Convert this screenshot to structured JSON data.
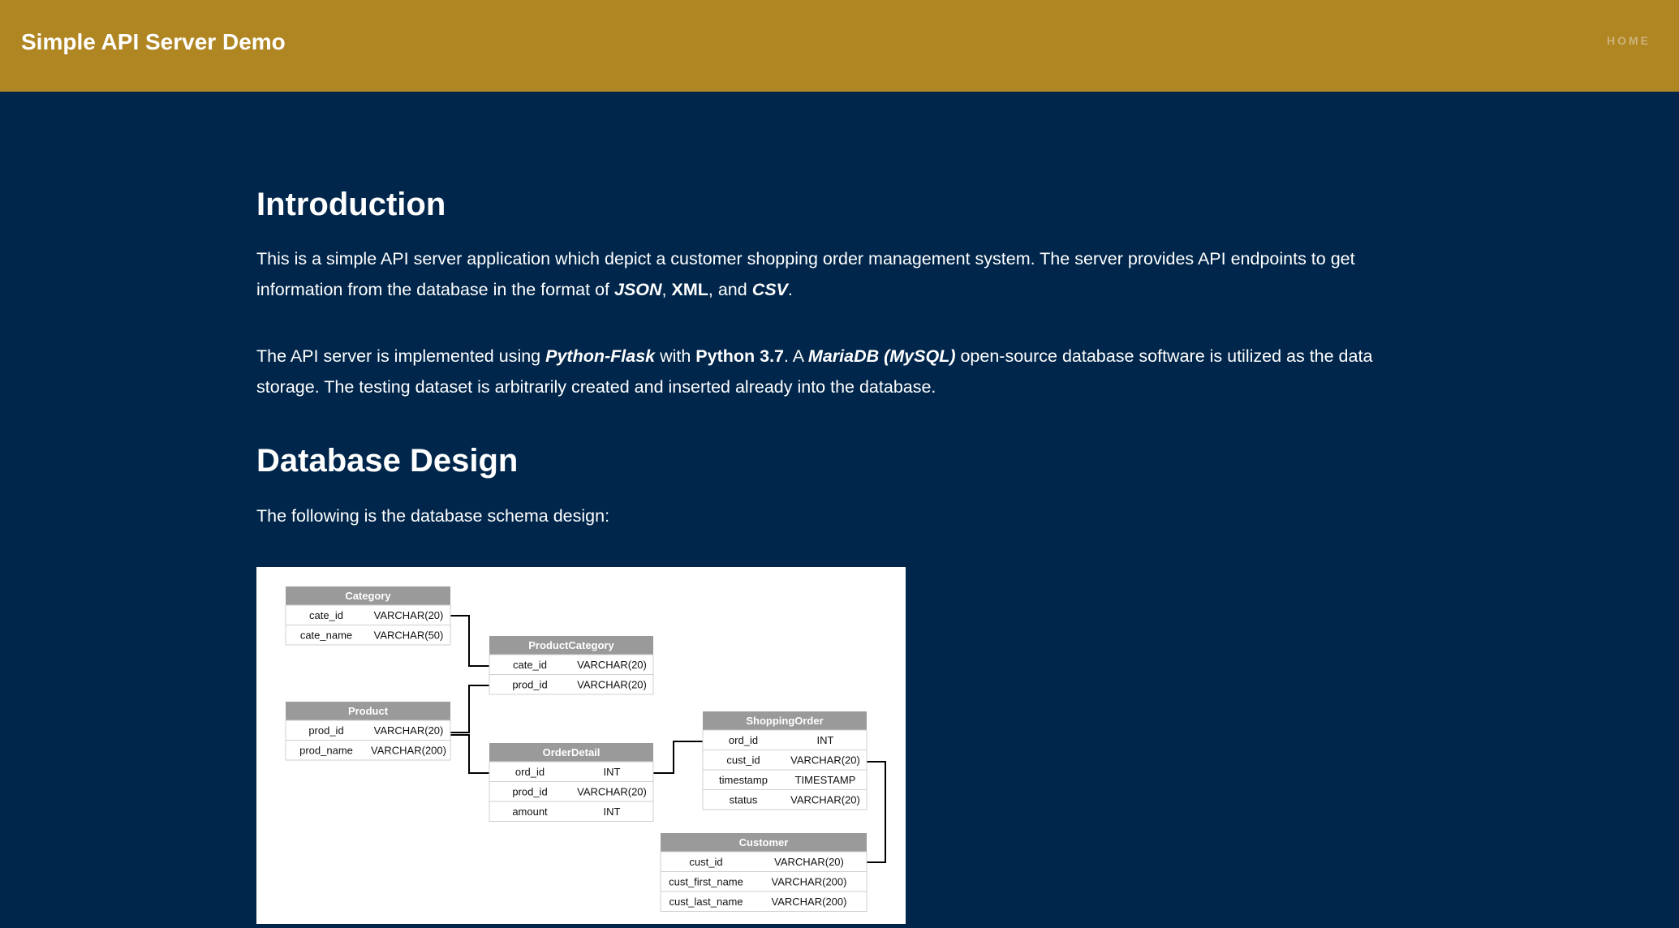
{
  "header": {
    "brand": "Simple API Server Demo",
    "nav_home": "HOME"
  },
  "intro": {
    "heading": "Introduction",
    "p1": {
      "t1": "This is a simple API server application which depict a customer shopping order management system. The server provides API endpoints to get information from the database in the format of ",
      "json": "JSON",
      "sep1": ", ",
      "xml": "XML",
      "sep2": ", and ",
      "csv": "CSV",
      "end": "."
    },
    "p2": {
      "t1": "The API server is implemented using ",
      "flask": "Python-Flask",
      "t2": " with ",
      "python": "Python 3.7",
      "t3": ". A ",
      "mariadb": "MariaDB (MySQL)",
      "t4": " open-source database software is utilized as the data storage. The testing dataset is arbitrarily created and inserted already into the database."
    }
  },
  "db": {
    "heading": "Database Design",
    "lead": "The following is the database schema design:"
  },
  "schema": {
    "tables": [
      {
        "name": "Category",
        "rows": [
          [
            "cate_id",
            "VARCHAR(20)"
          ],
          [
            "cate_name",
            "VARCHAR(50)"
          ]
        ]
      },
      {
        "name": "ProductCategory",
        "rows": [
          [
            "cate_id",
            "VARCHAR(20)"
          ],
          [
            "prod_id",
            "VARCHAR(20)"
          ]
        ]
      },
      {
        "name": "Product",
        "rows": [
          [
            "prod_id",
            "VARCHAR(20)"
          ],
          [
            "prod_name",
            "VARCHAR(200)"
          ]
        ]
      },
      {
        "name": "OrderDetail",
        "rows": [
          [
            "ord_id",
            "INT"
          ],
          [
            "prod_id",
            "VARCHAR(20)"
          ],
          [
            "amount",
            "INT"
          ]
        ]
      },
      {
        "name": "ShoppingOrder",
        "rows": [
          [
            "ord_id",
            "INT"
          ],
          [
            "cust_id",
            "VARCHAR(20)"
          ],
          [
            "timestamp",
            "TIMESTAMP"
          ],
          [
            "status",
            "VARCHAR(20)"
          ]
        ]
      },
      {
        "name": "Customer",
        "rows": [
          [
            "cust_id",
            "VARCHAR(20)"
          ],
          [
            "cust_first_name",
            "VARCHAR(200)"
          ],
          [
            "cust_last_name",
            "VARCHAR(200)"
          ]
        ]
      }
    ]
  }
}
